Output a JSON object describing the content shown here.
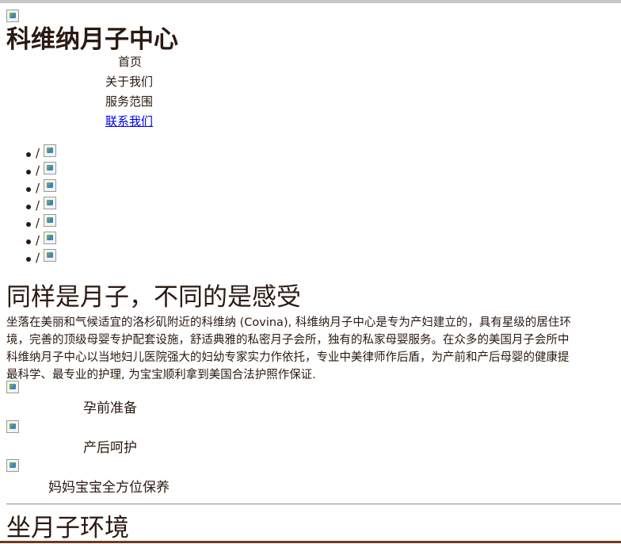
{
  "site": {
    "title": "科维纳月子中心"
  },
  "nav": {
    "items": [
      {
        "label": "首页"
      },
      {
        "label": "关于我们"
      },
      {
        "label": "服务范围"
      },
      {
        "label": "联系我们"
      }
    ]
  },
  "slider": {
    "separator": "/"
  },
  "intro": {
    "heading": "同样是月子，不同的是感受",
    "lines": [
      "坐落在美丽和气候适宜的洛杉矶附近的科维纳 (Covina), 科维纳月子中心是专为产妇建立的，具有星级的居住环",
      "境，完善的顶级母婴专护配套设施，舒适典雅的私密月子会所，独有的私家母婴服务。在众多的美国月子会所中",
      "科维纳月子中心以当地妇儿医院强大的妇幼专家实力作依托，专业中美律师作后盾，为产前和产后母婴的健康提",
      "最科学、最专业的护理, 为宝宝顺利拿到美国合法护照作保证."
    ]
  },
  "services": [
    {
      "label": "孕前准备"
    },
    {
      "label": "产后呵护"
    },
    {
      "label": "妈妈宝宝全方位保养"
    }
  ],
  "environment": {
    "heading": "坐月子环境"
  },
  "colors": {
    "text": "#2b1a12",
    "link": "#0000ee",
    "footer_band": "#6b3b22"
  }
}
